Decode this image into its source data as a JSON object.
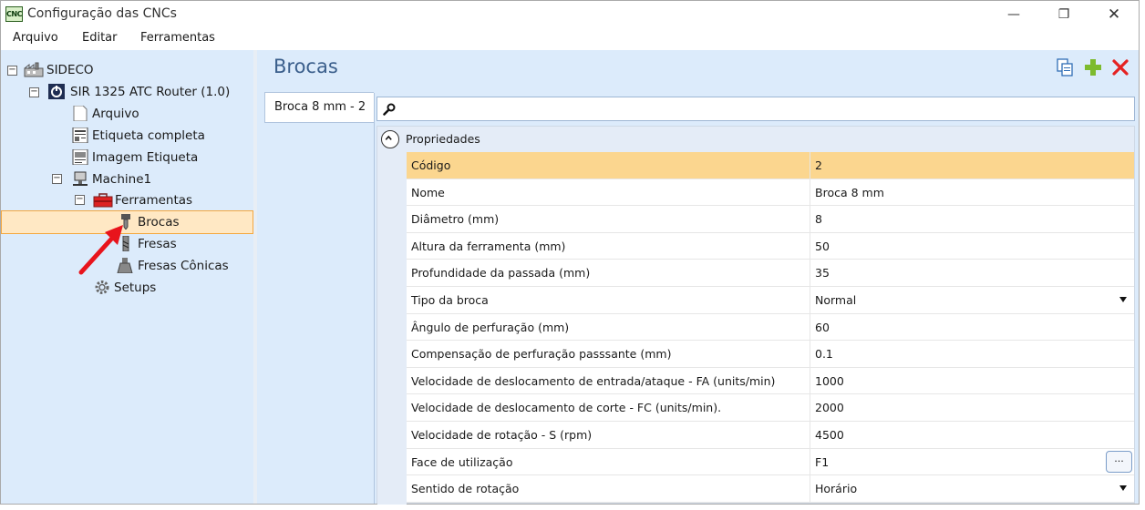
{
  "window": {
    "app_icon": "CNC",
    "title": "Configuração das CNCs",
    "minimize_icon": "—",
    "maximize_icon": "❐",
    "close_icon": "✕"
  },
  "menu": [
    "Arquivo",
    "Editar",
    "Ferramentas"
  ],
  "tree": {
    "root": "SIDECO",
    "router": "SIR 1325 ATC Router (1.0)",
    "items": [
      "Arquivo",
      "Etiqueta completa",
      "Imagem Etiqueta"
    ],
    "machine": "Machine1",
    "tools_folder": "Ferramentas",
    "tools": [
      "Brocas",
      "Fresas",
      "Fresas Cônicas"
    ],
    "setups": "Setups",
    "selected": "Brocas"
  },
  "main": {
    "title": "Brocas",
    "tab_label": "Broca 8 mm - 2",
    "group_label": "Propriedades",
    "search_value": "",
    "ellipsis_label": "...",
    "properties": [
      {
        "name": "Código",
        "value": "2",
        "selected": true
      },
      {
        "name": "Nome",
        "value": "Broca 8 mm"
      },
      {
        "name": "Diâmetro (mm)",
        "value": "8"
      },
      {
        "name": "Altura da ferramenta (mm)",
        "value": "50"
      },
      {
        "name": "Profundidade da passada (mm)",
        "value": "35"
      },
      {
        "name": "Tipo da broca",
        "value": "Normal",
        "dropdown": true
      },
      {
        "name": "Ângulo de perfuração (mm)",
        "value": "60"
      },
      {
        "name": "Compensação de perfuração passsante (mm)",
        "value": "0.1"
      },
      {
        "name": "Velocidade de deslocamento de entrada/ataque - FA (units/min)",
        "value": "1000"
      },
      {
        "name": "Velocidade de deslocamento de corte - FC (units/min).",
        "value": "2000"
      },
      {
        "name": "Velocidade de rotação - S (rpm)",
        "value": "4500"
      },
      {
        "name": "Face de utilização",
        "value": "F1",
        "ellipsis": true
      },
      {
        "name": "Sentido de rotação",
        "value": "Horário",
        "dropdown": true
      }
    ]
  },
  "colors": {
    "panel_bg": "#dcebfb",
    "selection_bg": "#ffe8c4",
    "selection_border": "#f4a840",
    "row_selected": "#fbd68f",
    "title_color": "#3b5f8c",
    "arrow": "#e8141c"
  }
}
